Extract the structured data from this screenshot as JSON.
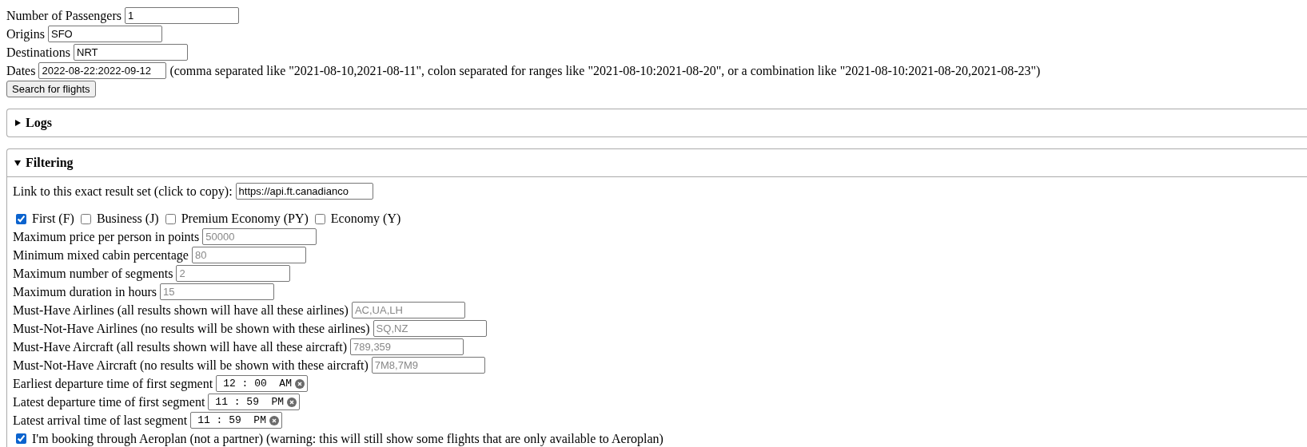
{
  "search_form": {
    "fields": [
      {
        "label": "Number of Passengers",
        "kind": "number",
        "value": "1"
      },
      {
        "label": "Origins",
        "kind": "text",
        "value": "SFO"
      },
      {
        "label": "Destinations",
        "kind": "text",
        "value": "NRT"
      },
      {
        "label": "Dates",
        "kind": "text",
        "value": "2022-08-22:2022-09-12",
        "hint": "(comma separated like \"2021-08-10,2021-08-11\", colon separated for ranges like \"2021-08-10:2021-08-20\", or a combination like \"2021-08-10:2021-08-20,2021-08-23\")"
      }
    ],
    "button": "Search for flights"
  },
  "sections": [
    {
      "title": "Logs",
      "expanded": false
    },
    {
      "title": "Filtering",
      "expanded": true
    }
  ],
  "filtering": {
    "link": {
      "label": "Link to this exact result set (click to copy):",
      "value": "https://api.ft.canadianco"
    },
    "cabins": [
      {
        "label": "First (F)",
        "checked": true
      },
      {
        "label": "Business (J)",
        "checked": false
      },
      {
        "label": "Premium Economy (PY)",
        "checked": false
      },
      {
        "label": "Economy (Y)",
        "checked": false
      }
    ],
    "filters": [
      {
        "label": "Maximum price per person in points",
        "kind": "number",
        "placeholder": "50000"
      },
      {
        "label": "Minimum mixed cabin percentage",
        "kind": "number",
        "placeholder": "80"
      },
      {
        "label": "Maximum number of segments",
        "kind": "number",
        "placeholder": "2"
      },
      {
        "label": "Maximum duration in hours",
        "kind": "number",
        "placeholder": "15"
      },
      {
        "label": "Must-Have Airlines (all results shown will have all these airlines)",
        "kind": "text",
        "placeholder": "AC,UA,LH"
      },
      {
        "label": "Must-Not-Have Airlines (no results will be shown with these airlines)",
        "kind": "text",
        "placeholder": "SQ,NZ"
      },
      {
        "label": "Must-Have Aircraft (all results shown will have all these aircraft)",
        "kind": "text",
        "placeholder": "789,359"
      },
      {
        "label": "Must-Not-Have Aircraft (no results will be shown with these aircraft)",
        "kind": "text",
        "placeholder": "7M8,7M9"
      },
      {
        "label": "Earliest departure time of first segment",
        "kind": "time",
        "value": "12 : 00  AM"
      },
      {
        "label": "Latest departure time of first segment",
        "kind": "time",
        "value": "11 : 59  PM"
      },
      {
        "label": "Latest arrival time of last segment",
        "kind": "time",
        "value": "11 : 59  PM"
      }
    ],
    "aeroplan": {
      "label": "I'm booking through Aeroplan (not a partner) (warning: this will still show some flights that are only available to Aeroplan)",
      "checked": true
    }
  }
}
